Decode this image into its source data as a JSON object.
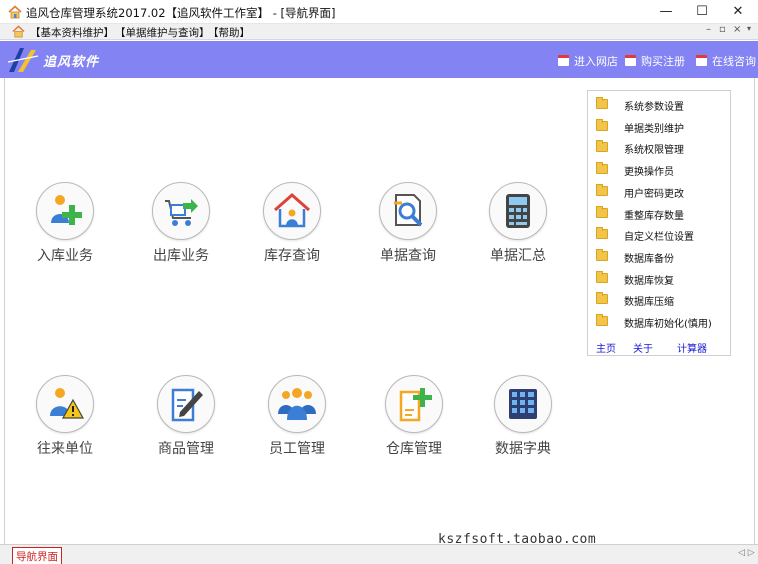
{
  "window": {
    "title": "追风仓库管理系统2017.02【追风软件工作室】 - [导航界面]",
    "minimize": "—",
    "maximize": "☐",
    "close": "✕"
  },
  "menubar": {
    "items": [
      "【基本资料维护】",
      "【单据维护与查询】",
      "【帮助】"
    ],
    "mdi_controls": [
      "–",
      "▫",
      "×"
    ]
  },
  "banner": {
    "logo_text": "追风软件",
    "links": [
      "进入网店",
      "购买注册",
      "在线咨询"
    ],
    "background": "#8383f3"
  },
  "modules": [
    {
      "label": "入库业务",
      "icon": "inbound-icon"
    },
    {
      "label": "出库业务",
      "icon": "outbound-cart-icon"
    },
    {
      "label": "库存查询",
      "icon": "warehouse-house-icon"
    },
    {
      "label": "单据查询",
      "icon": "document-search-icon"
    },
    {
      "label": "单据汇总",
      "icon": "calculator-icon"
    },
    {
      "label": "往来单位",
      "icon": "contact-warning-icon"
    },
    {
      "label": "商品管理",
      "icon": "edit-document-icon"
    },
    {
      "label": "员工管理",
      "icon": "people-group-icon"
    },
    {
      "label": "仓库管理",
      "icon": "add-document-icon"
    },
    {
      "label": "数据字典",
      "icon": "grid-dictionary-icon"
    }
  ],
  "side_panel": {
    "items": [
      "系统参数设置",
      "单据类别维护",
      "系统权限管理",
      "更换操作员",
      "用户密码更改",
      "重整库存数量",
      "自定义栏位设置",
      "数据库备份",
      "数据库恢复",
      "数据库压缩",
      "数据库初始化(慎用)"
    ],
    "links": [
      "主页",
      "关于",
      "计算器"
    ]
  },
  "watermark": "kszfsoft.taobao.com",
  "status": {
    "active_tab": "导航界面",
    "scroll": "◁ ▷"
  }
}
